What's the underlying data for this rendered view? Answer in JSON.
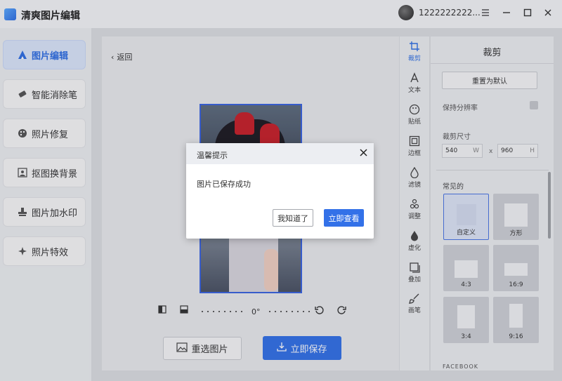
{
  "app": {
    "title": "清爽图片编辑",
    "username": "1222222222..."
  },
  "window": {
    "menu_icon": "menu-icon",
    "minimize_icon": "minimize-icon",
    "maximize_icon": "maximize-icon",
    "close_icon": "close-icon"
  },
  "sidebar": {
    "items": [
      {
        "label": "图片编辑",
        "icon": "image-edit-icon",
        "active": true
      },
      {
        "label": "智能消除笔",
        "icon": "eraser-icon",
        "active": false
      },
      {
        "label": "照片修复",
        "icon": "palette-icon",
        "active": false
      },
      {
        "label": "抠图换背景",
        "icon": "cutout-icon",
        "active": false
      },
      {
        "label": "图片加水印",
        "icon": "stamp-icon",
        "active": false
      },
      {
        "label": "照片特效",
        "icon": "sparkle-icon",
        "active": false
      }
    ]
  },
  "main": {
    "back_label": "返回",
    "rotation_value": "0°",
    "reselect_label": "重选图片",
    "save_label": "立即保存"
  },
  "tools": [
    {
      "label": "裁剪",
      "icon": "crop-icon",
      "active": true
    },
    {
      "label": "文本",
      "icon": "text-icon",
      "active": false
    },
    {
      "label": "贴纸",
      "icon": "sticker-icon",
      "active": false
    },
    {
      "label": "边框",
      "icon": "frame-icon",
      "active": false
    },
    {
      "label": "滤镜",
      "icon": "filter-icon",
      "active": false
    },
    {
      "label": "调整",
      "icon": "adjust-icon",
      "active": false
    },
    {
      "label": "虚化",
      "icon": "blur-icon",
      "active": false
    },
    {
      "label": "叠加",
      "icon": "overlay-icon",
      "active": false
    },
    {
      "label": "画笔",
      "icon": "brush-icon",
      "active": false
    }
  ],
  "panel": {
    "title": "裁剪",
    "reset_label": "重置为默认",
    "keep_resolution_label": "保持分辨率",
    "crop_size_label": "裁剪尺寸",
    "width_value": "540",
    "width_unit": "W",
    "times": "x",
    "height_value": "960",
    "height_unit": "H",
    "common_label": "常见的",
    "ratios": [
      "自定义",
      "方形",
      "4:3",
      "16:9",
      "3:4",
      "9:16"
    ],
    "footer_label": "FACEBOOK"
  },
  "dialog": {
    "title": "温馨提示",
    "message": "图片已保存成功",
    "ok_label": "我知道了",
    "view_label": "立即查看"
  },
  "colors": {
    "accent": "#3371e8",
    "selection": "#3a63e0"
  }
}
